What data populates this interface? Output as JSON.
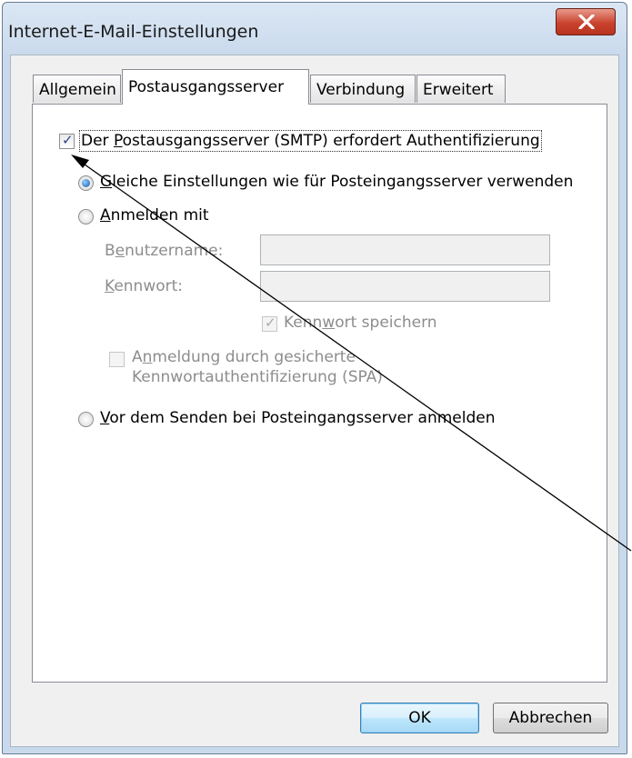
{
  "window": {
    "title": "Internet-E-Mail-Einstellungen"
  },
  "tabs": [
    {
      "label": "Allgemein"
    },
    {
      "label": "Postausgangsserver"
    },
    {
      "label": "Verbindung"
    },
    {
      "label": "Erweitert"
    }
  ],
  "active_tab": "Postausgangsserver",
  "smtp_auth": {
    "checked": true,
    "label_pre": "Der ",
    "label_key": "P",
    "label_post": "ostausgangsserver (SMTP) erfordert Authentifizierung"
  },
  "option_same": {
    "selected": true,
    "label_key": "G",
    "label_post": "leiche Einstellungen wie für Posteingangsserver verwenden"
  },
  "option_login": {
    "selected": false,
    "label_key": "A",
    "label_post": "nmelden mit"
  },
  "username": {
    "label_pre": "B",
    "label_key": "e",
    "label_post": "nutzername:",
    "value": ""
  },
  "password": {
    "label_key": "K",
    "label_post": "ennwort:",
    "value": ""
  },
  "save_password": {
    "checked": true,
    "label_pre": "Kenn",
    "label_key": "w",
    "label_post": "ort speichern"
  },
  "spa": {
    "checked": false,
    "label_line1_pre": "A",
    "label_line1_key": "n",
    "label_line1_post": "meldung durch gesicherte",
    "label_line2": "Kennwortauthentifizierung (SPA)"
  },
  "option_before_send": {
    "selected": false,
    "label_key": "V",
    "label_post": "or dem Senden bei Posteingangsserver anmelden"
  },
  "buttons": {
    "ok": "OK",
    "cancel": "Abbrechen"
  },
  "colors": {
    "title_bar": "#c9d9ec",
    "close_button": "#c9432f",
    "arrow": "#000000"
  }
}
